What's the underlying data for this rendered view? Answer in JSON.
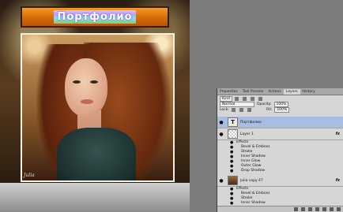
{
  "canvas": {
    "title": "Портфолио",
    "watermark": "Julia"
  },
  "panel": {
    "tabs": [
      "Properties",
      "Tool Presets",
      "Actions",
      "Layers",
      "History"
    ],
    "active_tab": "Layers",
    "filter_kind": "Kind",
    "blend_mode": "Normal",
    "opacity_label": "Opacity:",
    "opacity_value": "100%",
    "lock_label": "Lock:",
    "fill_label": "Fill:",
    "fill_value": "100%",
    "layers": [
      {
        "name": "Портфолио",
        "type": "text",
        "selected": true
      },
      {
        "name": "Layer 1",
        "type": "raster",
        "fx": "fx",
        "effects_label": "Effects",
        "effects": [
          "Bevel & Emboss",
          "Stroke",
          "Inner Shadow",
          "Inner Glow",
          "Outer Glow",
          "Drop Shadow"
        ]
      },
      {
        "name": "Julia copy 47",
        "type": "photo",
        "fx": "fx",
        "effects_label": "Effects",
        "effects": [
          "Bevel & Emboss",
          "Stroke",
          "Inner Shadow"
        ]
      }
    ]
  }
}
